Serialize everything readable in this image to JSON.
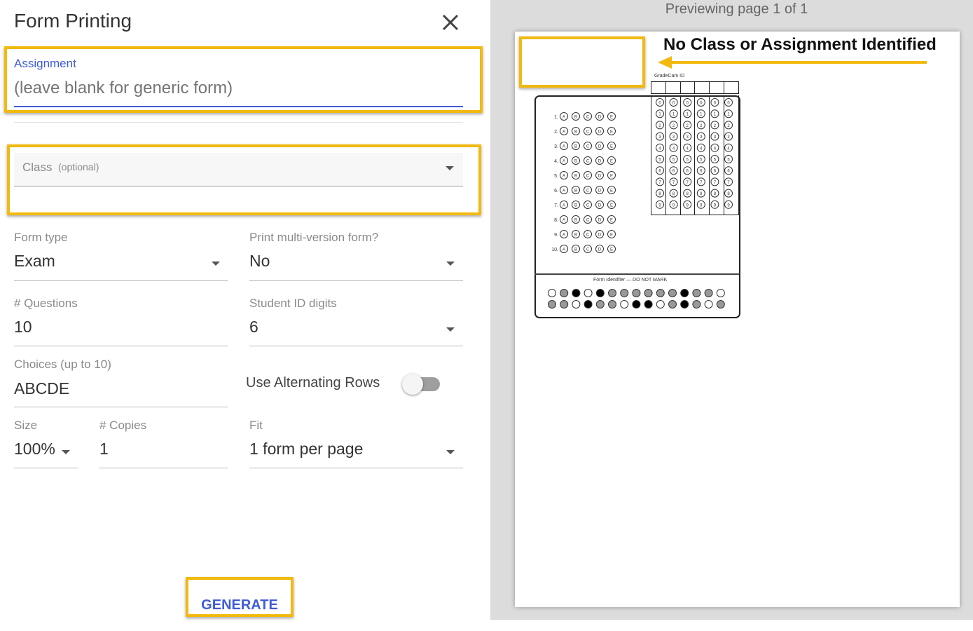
{
  "dialog": {
    "title": "Form Printing",
    "close_icon": "close-icon"
  },
  "assignment": {
    "label": "Assignment",
    "placeholder": "(leave blank for generic form)",
    "value": ""
  },
  "class_field": {
    "label": "Class",
    "hint": "(optional)",
    "value": ""
  },
  "form_type": {
    "label": "Form type",
    "value": "Exam"
  },
  "multi_version": {
    "label": "Print multi-version form?",
    "value": "No"
  },
  "questions": {
    "label": "# Questions",
    "value": "10"
  },
  "student_id": {
    "label": "Student ID digits",
    "value": "6"
  },
  "choices": {
    "label": "Choices (up to 10)",
    "value": "ABCDE"
  },
  "alternating": {
    "label": "Use Alternating Rows",
    "enabled": false
  },
  "size": {
    "label": "Size",
    "value": "100%"
  },
  "copies": {
    "label": "# Copies",
    "value": "1"
  },
  "fit": {
    "label": "Fit",
    "value": "1 form per page"
  },
  "generate_label": "GENERATE",
  "preview": {
    "status": "Previewing page 1 of 1",
    "annotation": "No Class or Assignment Identified",
    "id_header": "GradeCam ID",
    "form_identifier": "Form Identifier — DO NOT MARK",
    "question_numbers": [
      "1.",
      "2.",
      "3.",
      "4.",
      "5.",
      "6.",
      "7.",
      "8.",
      "9.",
      "10."
    ],
    "choice_letters": [
      "A",
      "B",
      "C",
      "D",
      "E"
    ],
    "id_digits": [
      "0",
      "1",
      "2",
      "3",
      "4",
      "5",
      "6",
      "7",
      "8",
      "9"
    ]
  },
  "colors": {
    "highlight": "#f2b90f",
    "accent": "#3f5bd8",
    "annotation_arrow": "#f2b90f"
  }
}
